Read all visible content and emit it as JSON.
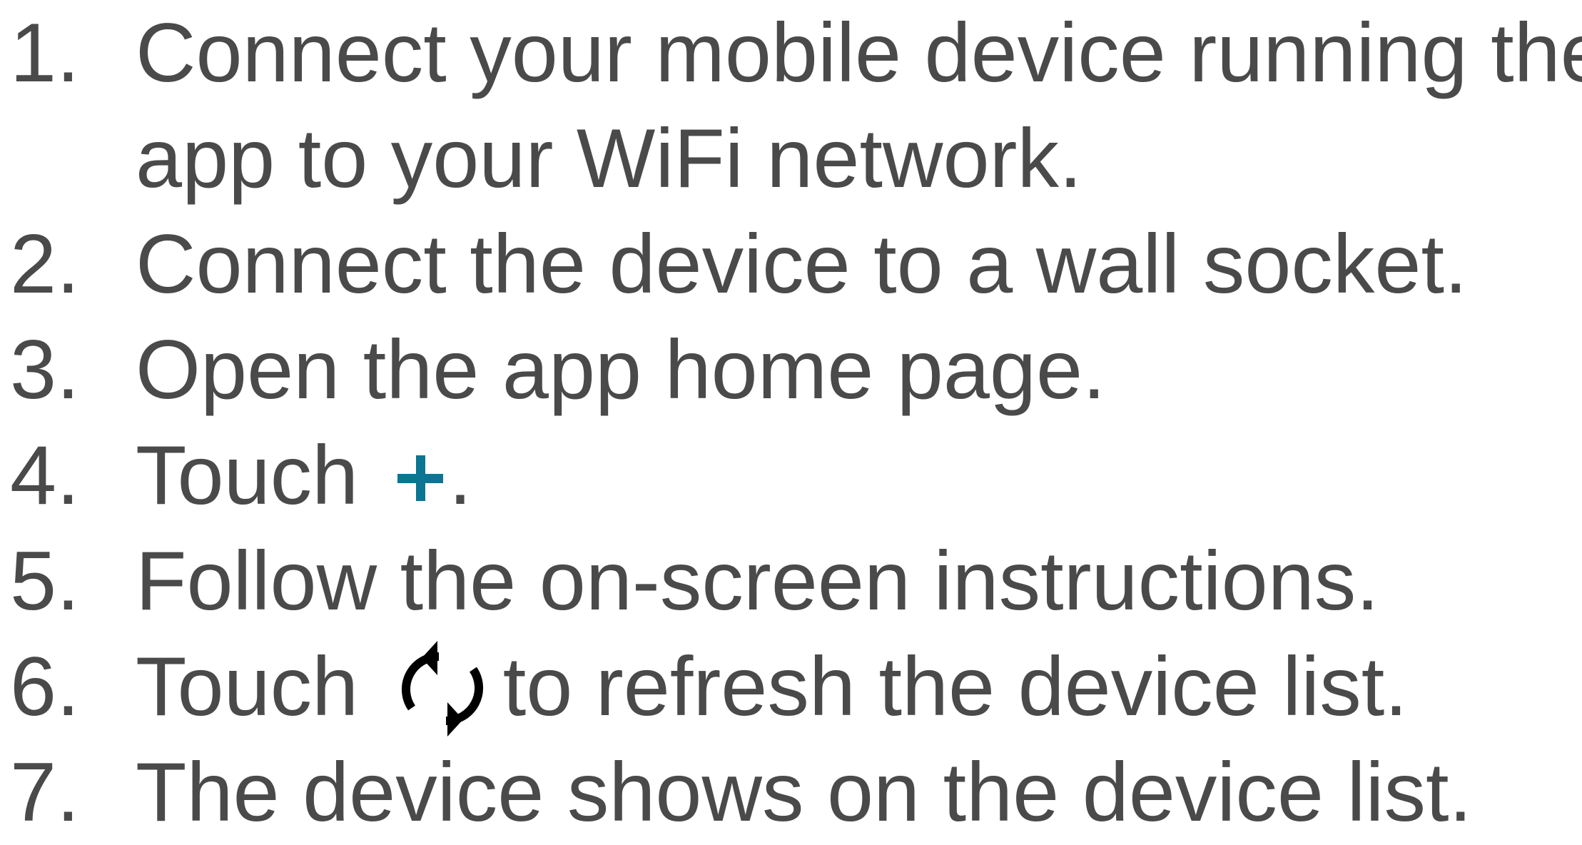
{
  "steps": [
    {
      "num": "1.",
      "line1": "Connect your mobile device running the",
      "line2": "app to your WiFi network."
    },
    {
      "num": "2.",
      "text": "Connect the device to a wall socket."
    },
    {
      "num": "3.",
      "text": "Open the app home page."
    },
    {
      "num": "4.",
      "before": "Touch",
      "after": ".",
      "icon": "plus-icon"
    },
    {
      "num": "5.",
      "text": "Follow the on-screen instructions."
    },
    {
      "num": "6.",
      "before": "Touch",
      "after": "to refresh the device list.",
      "icon": "refresh-icon"
    },
    {
      "num": "7.",
      "text": "The device shows on the device list."
    }
  ],
  "colors": {
    "text": "#4a4a4a",
    "plus_icon": "#0b7593",
    "refresh_icon": "#000000"
  }
}
